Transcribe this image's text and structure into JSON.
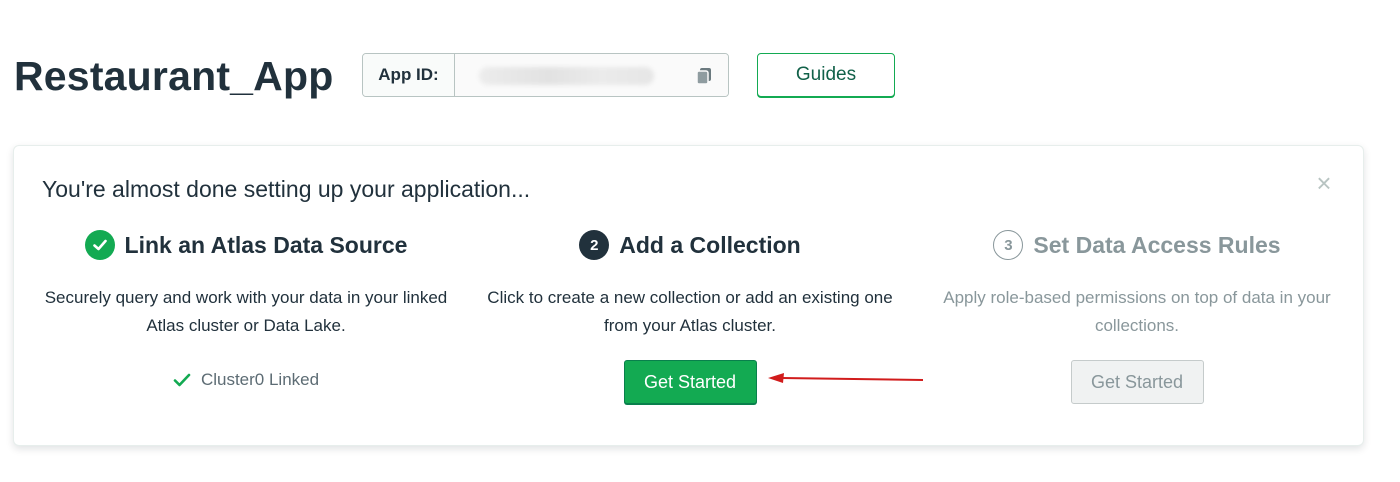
{
  "header": {
    "app_title": "Restaurant_App",
    "app_id_label": "App ID:",
    "guides_label": "Guides"
  },
  "setup": {
    "title": "You're almost done setting up your application...",
    "close_symbol": "×",
    "steps": [
      {
        "badge": "check",
        "title": "Link an Atlas Data Source",
        "description": "Securely query and work with your data in your linked Atlas cluster or Data Lake.",
        "status": "Cluster0 Linked"
      },
      {
        "badge": "2",
        "title": "Add a Collection",
        "description": "Click to create a new collection or add an existing one from your Atlas cluster.",
        "button_label": "Get Started"
      },
      {
        "badge": "3",
        "title": "Set Data Access Rules",
        "description": "Apply role-based permissions on top of data in your collections.",
        "button_label": "Get Started"
      }
    ]
  },
  "colors": {
    "primary_green": "#13aa52",
    "text_dark": "#21313c",
    "text_muted": "#89979b",
    "annotation_arrow": "#d11c1c"
  },
  "icons": [
    "copy-icon",
    "close-icon",
    "check-circle-icon",
    "check-icon"
  ]
}
